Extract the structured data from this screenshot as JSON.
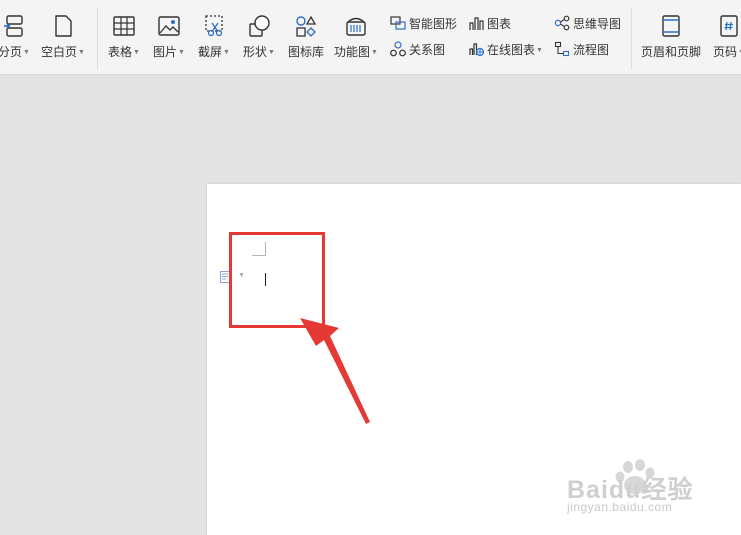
{
  "ribbon": {
    "page_break_label": "分页",
    "blank_page_label": "空白页",
    "table_label": "表格",
    "picture_label": "图片",
    "screenshot_label": "截屏",
    "shape_label": "形状",
    "icon_library_label": "图标库",
    "function_chart_label": "功能图",
    "smart_art_label": "智能图形",
    "relation_chart_label": "关系图",
    "chart_label": "图表",
    "online_chart_label": "在线图表",
    "mind_map_label": "思维导图",
    "flowchart_label": "流程图",
    "header_footer_label": "页眉和页脚",
    "page_number_label": "页码"
  },
  "watermark": {
    "brand": "Baidu经验",
    "url": "jingyan.baidu.com"
  },
  "colors": {
    "accent_blue": "#2b6fc9",
    "annotation_red": "#e53935"
  }
}
